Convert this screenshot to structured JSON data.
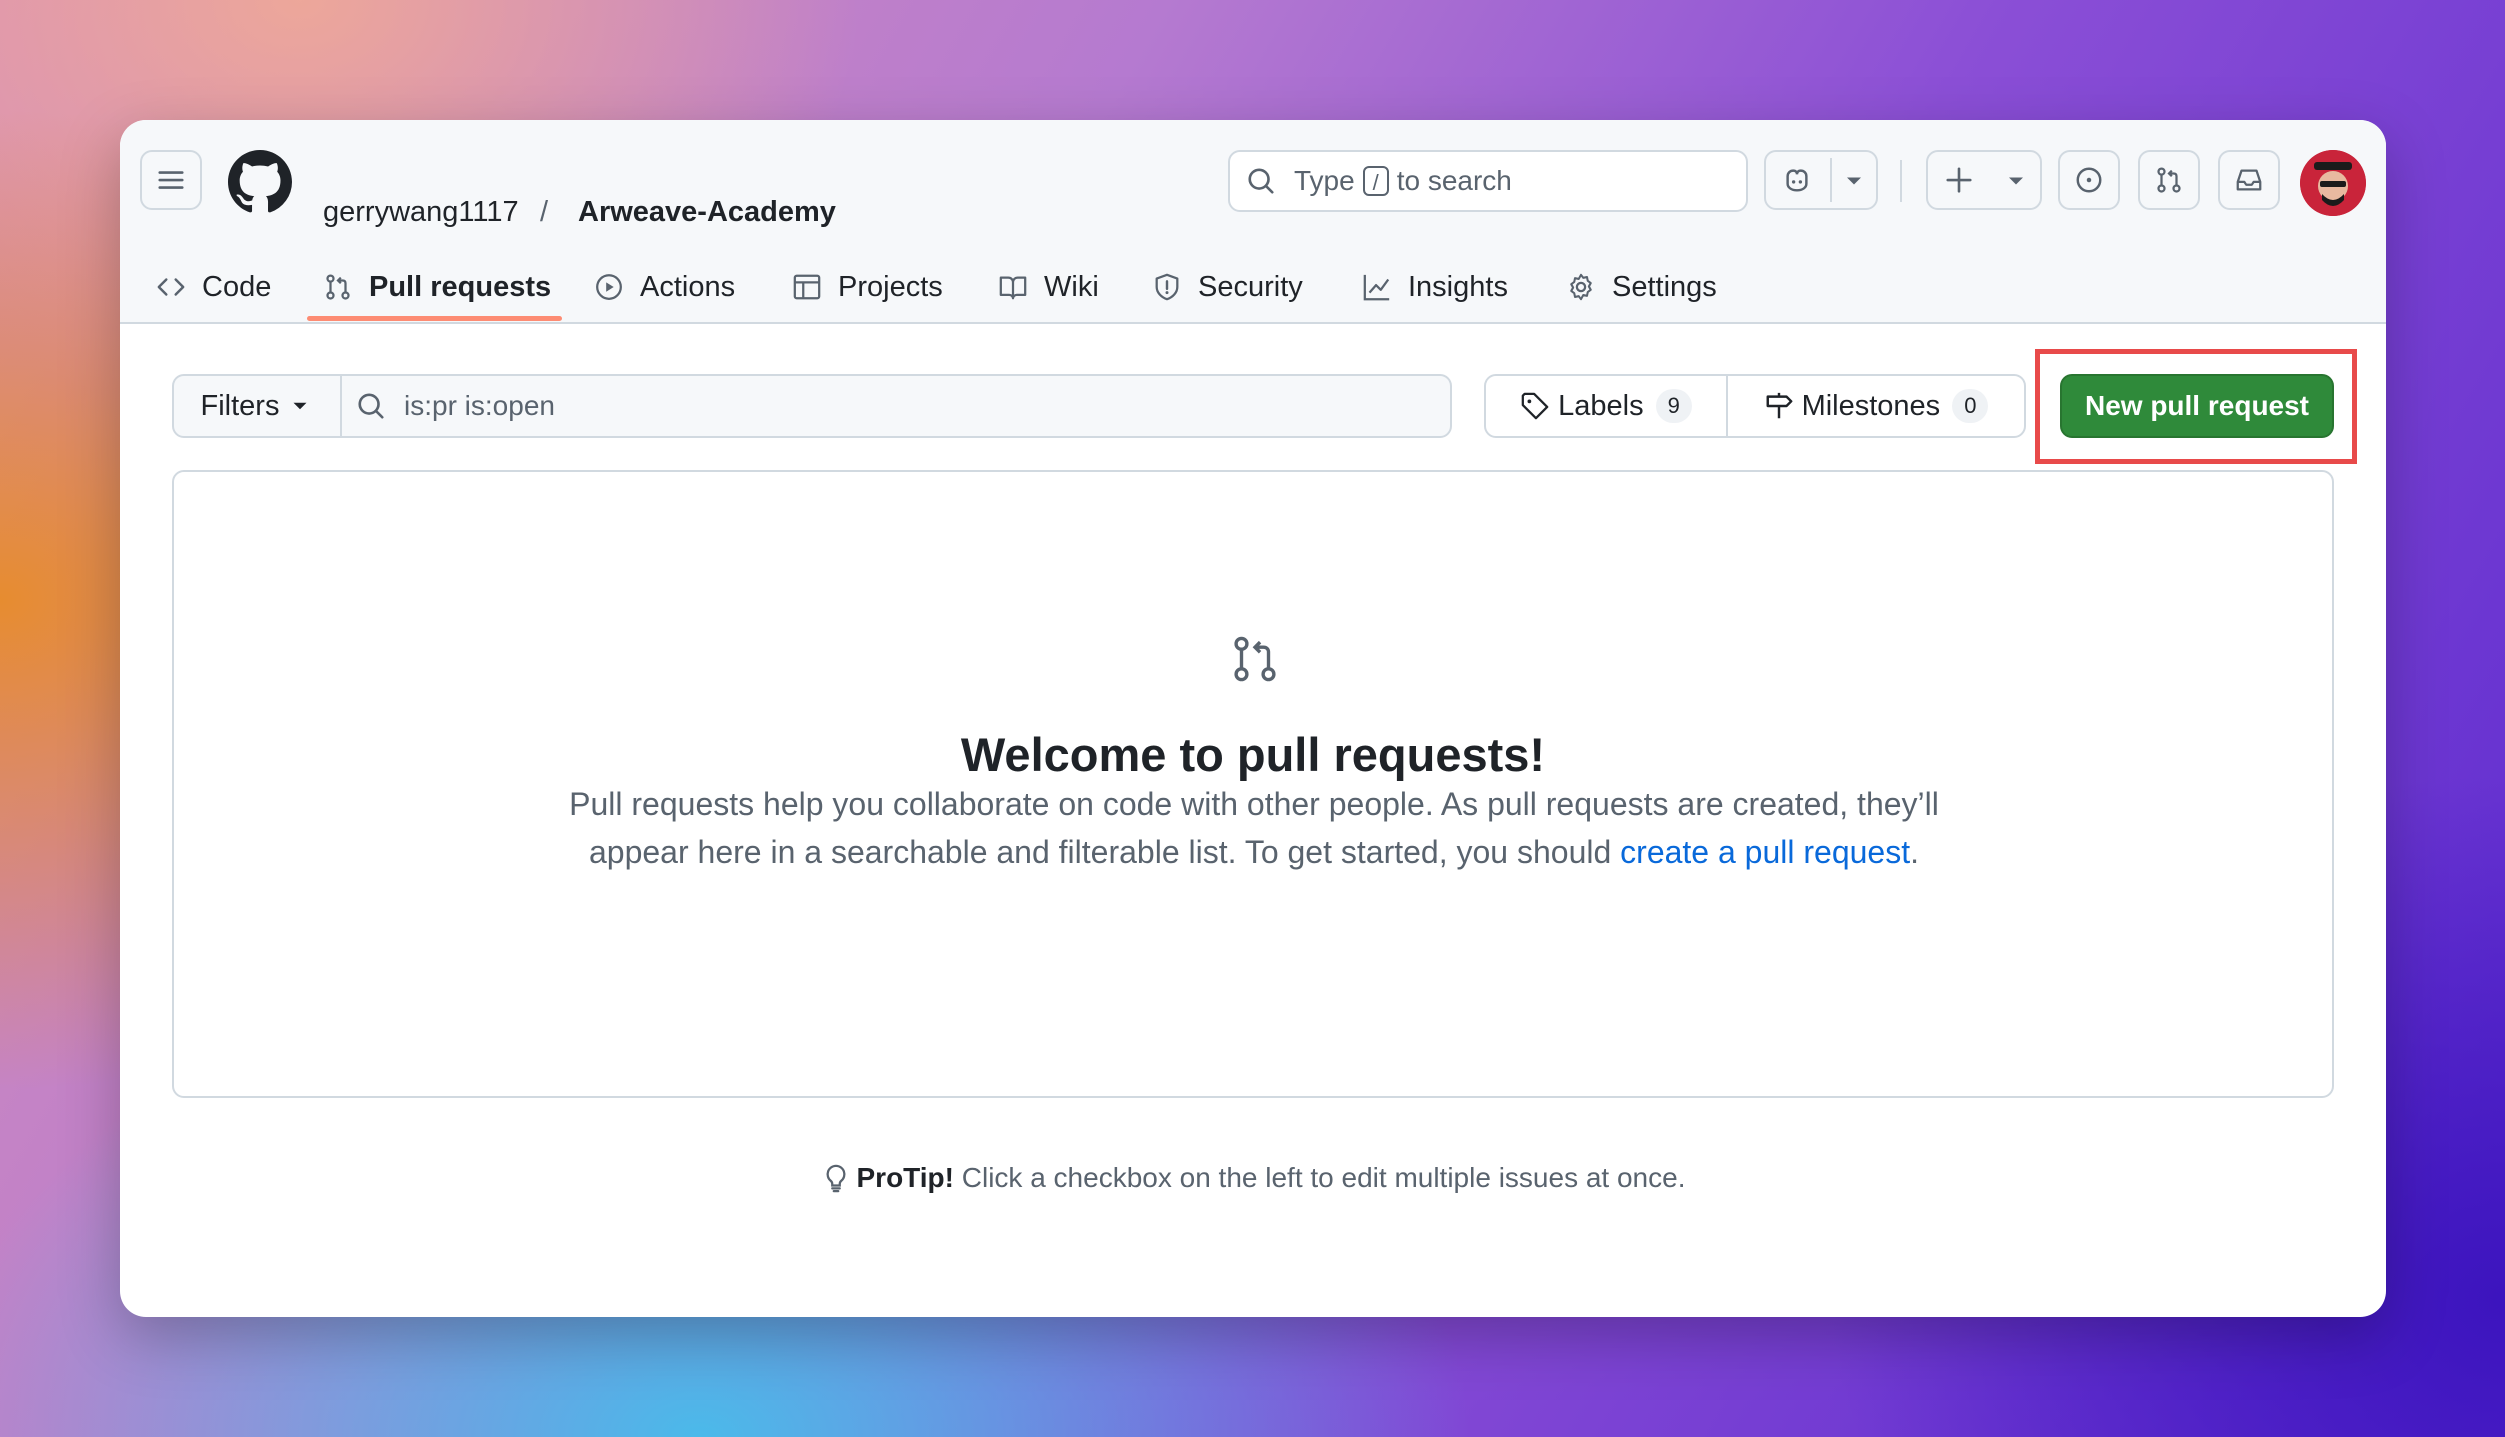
{
  "header": {
    "owner": "gerrywang1117",
    "separator": "/",
    "repo": "Arweave-Academy",
    "search": {
      "prefix": "Type",
      "key": "/",
      "suffix": "to search"
    }
  },
  "tabs": [
    {
      "label": "Code",
      "icon": "code-icon"
    },
    {
      "label": "Pull requests",
      "icon": "git-pull-request-icon",
      "active": true
    },
    {
      "label": "Actions",
      "icon": "play-icon"
    },
    {
      "label": "Projects",
      "icon": "table-icon"
    },
    {
      "label": "Wiki",
      "icon": "book-icon"
    },
    {
      "label": "Security",
      "icon": "shield-icon"
    },
    {
      "label": "Insights",
      "icon": "graph-icon"
    },
    {
      "label": "Settings",
      "icon": "gear-icon"
    }
  ],
  "filterbar": {
    "filters_label": "Filters",
    "query": "is:pr is:open",
    "labels_label": "Labels",
    "labels_count": "9",
    "milestones_label": "Milestones",
    "milestones_count": "0",
    "new_pr_label": "New pull request"
  },
  "blankslate": {
    "title": "Welcome to pull requests!",
    "text": "Pull requests help you collaborate on code with other people. As pull requests are created, they’ll appear here in a searchable and filterable list. To get started, you should ",
    "link": "create a pull request",
    "end": "."
  },
  "protip": {
    "strong": "ProTip!",
    "text": " Click a checkbox on the left to edit multiple issues at once."
  },
  "colors": {
    "primary_button": "#2f8a3a",
    "annotation": "#e84a4a",
    "link": "#0969da",
    "tab_underline": "#fd8c73"
  }
}
